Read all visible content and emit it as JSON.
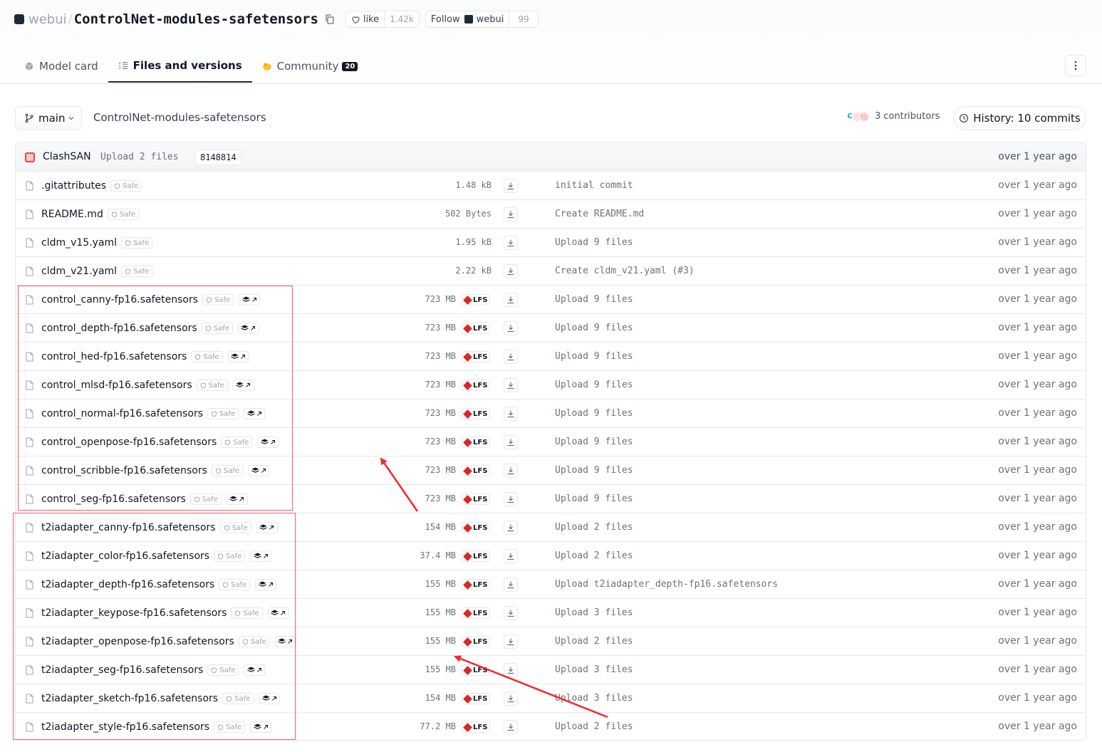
{
  "header": {
    "org": "webui",
    "repo": "ControlNet-modules-safetensors",
    "like_label": "like",
    "like_count": "1.42k",
    "follow_label": "Follow",
    "follow_org": "webui",
    "follow_count": "99"
  },
  "tabs": [
    {
      "label": "Model card"
    },
    {
      "label": "Files and versions"
    },
    {
      "label": "Community",
      "badge": "20"
    }
  ],
  "toolbar": {
    "branch": "main",
    "breadcrumb": "ControlNet-modules-safetensors",
    "contributors": "3 contributors",
    "history": "History: 10 commits"
  },
  "last_commit": {
    "author": "ClashSAN",
    "message": "Upload 2 files",
    "hash": "8148814",
    "time": "over 1 year ago"
  },
  "safe_label": "Safe",
  "lfs_label": "LFS",
  "files": [
    {
      "name": ".gitattributes",
      "size": "1.48 kB",
      "lfs": false,
      "st": false,
      "message": "initial commit",
      "time": "over 1 year ago"
    },
    {
      "name": "README.md",
      "size": "502 Bytes",
      "lfs": false,
      "st": false,
      "message": "Create README.md",
      "time": "over 1 year ago"
    },
    {
      "name": "cldm_v15.yaml",
      "size": "1.95 kB",
      "lfs": false,
      "st": false,
      "message": "Upload 9 files",
      "time": "over 1 year ago"
    },
    {
      "name": "cldm_v21.yaml",
      "size": "2.22 kB",
      "lfs": false,
      "st": false,
      "message": "Create cldm_v21.yaml (#3)",
      "time": "over 1 year ago"
    },
    {
      "name": "control_canny-fp16.safetensors",
      "size": "723 MB",
      "lfs": true,
      "st": true,
      "message": "Upload 9 files",
      "time": "over 1 year ago"
    },
    {
      "name": "control_depth-fp16.safetensors",
      "size": "723 MB",
      "lfs": true,
      "st": true,
      "message": "Upload 9 files",
      "time": "over 1 year ago"
    },
    {
      "name": "control_hed-fp16.safetensors",
      "size": "723 MB",
      "lfs": true,
      "st": true,
      "message": "Upload 9 files",
      "time": "over 1 year ago"
    },
    {
      "name": "control_mlsd-fp16.safetensors",
      "size": "723 MB",
      "lfs": true,
      "st": true,
      "message": "Upload 9 files",
      "time": "over 1 year ago"
    },
    {
      "name": "control_normal-fp16.safetensors",
      "size": "723 MB",
      "lfs": true,
      "st": true,
      "message": "Upload 9 files",
      "time": "over 1 year ago"
    },
    {
      "name": "control_openpose-fp16.safetensors",
      "size": "723 MB",
      "lfs": true,
      "st": true,
      "message": "Upload 9 files",
      "time": "over 1 year ago"
    },
    {
      "name": "control_scribble-fp16.safetensors",
      "size": "723 MB",
      "lfs": true,
      "st": true,
      "message": "Upload 9 files",
      "time": "over 1 year ago"
    },
    {
      "name": "control_seg-fp16.safetensors",
      "size": "723 MB",
      "lfs": true,
      "st": true,
      "message": "Upload 9 files",
      "time": "over 1 year ago"
    },
    {
      "name": "t2iadapter_canny-fp16.safetensors",
      "size": "154 MB",
      "lfs": true,
      "st": true,
      "message": "Upload 2 files",
      "time": "over 1 year ago"
    },
    {
      "name": "t2iadapter_color-fp16.safetensors",
      "size": "37.4 MB",
      "lfs": true,
      "st": true,
      "message": "Upload 2 files",
      "time": "over 1 year ago"
    },
    {
      "name": "t2iadapter_depth-fp16.safetensors",
      "size": "155 MB",
      "lfs": true,
      "st": true,
      "message": "Upload t2iadapter_depth-fp16.safetensors",
      "time": "over 1 year ago"
    },
    {
      "name": "t2iadapter_keypose-fp16.safetensors",
      "size": "155 MB",
      "lfs": true,
      "st": true,
      "message": "Upload 3 files",
      "time": "over 1 year ago"
    },
    {
      "name": "t2iadapter_openpose-fp16.safetensors",
      "size": "155 MB",
      "lfs": true,
      "st": true,
      "message": "Upload 2 files",
      "time": "over 1 year ago"
    },
    {
      "name": "t2iadapter_seg-fp16.safetensors",
      "size": "155 MB",
      "lfs": true,
      "st": true,
      "message": "Upload 3 files",
      "time": "over 1 year ago"
    },
    {
      "name": "t2iadapter_sketch-fp16.safetensors",
      "size": "154 MB",
      "lfs": true,
      "st": true,
      "message": "Upload 3 files",
      "time": "over 1 year ago"
    },
    {
      "name": "t2iadapter_style-fp16.safetensors",
      "size": "77.2 MB",
      "lfs": true,
      "st": true,
      "message": "Upload 2 files",
      "time": "over 1 year ago"
    }
  ],
  "colors": {
    "annotation": "#ef4444",
    "lfs_icon": "#dc2626"
  }
}
